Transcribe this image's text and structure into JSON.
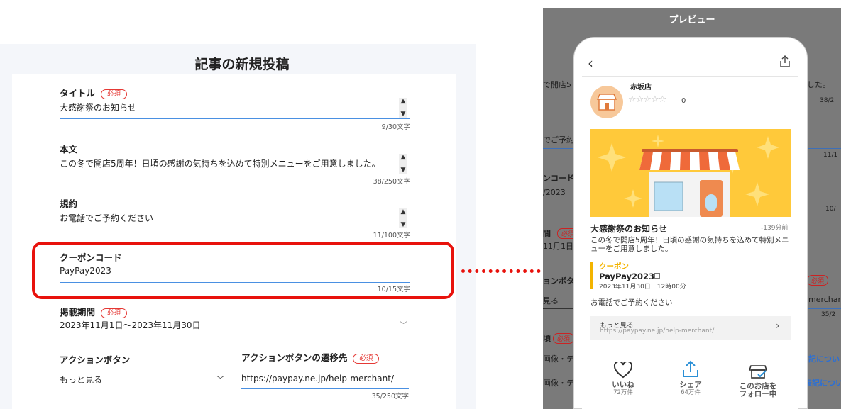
{
  "form": {
    "title": "記事の新規投稿",
    "required_label": "必須",
    "fields": {
      "title": {
        "label": "タイトル",
        "value": "大感謝祭のお知らせ",
        "count": "9/30文字"
      },
      "body": {
        "label": "本文",
        "value": "この冬で開店5周年！日頃の感謝の気持ちを込めて特別メニューをご用意しました。",
        "count": "38/250文字"
      },
      "terms": {
        "label": "規約",
        "value": "お電話でご予約ください",
        "count": "11/100文字"
      },
      "coupon": {
        "label": "クーポンコード",
        "value": "PayPay2023",
        "count": "10/15文字"
      },
      "period": {
        "label": "掲載期間",
        "value": "2023年11月1日～2023年11月30日"
      },
      "action_button": {
        "label": "アクションボタン",
        "value": "もっと見る"
      },
      "action_url": {
        "label": "アクションボタンの遷移先",
        "value": "https://paypay.ne.jp/help-merchant/",
        "count": "35/250文字"
      }
    }
  },
  "preview": {
    "title": "プレビュー",
    "shop_name": "赤坂店",
    "rating_count": "0",
    "post_title": "大感謝祭のお知らせ",
    "post_time": "-139分前",
    "post_body": "この冬で開店5周年！日頃の感謝の気持ちを込めて特別メニューをご用意しました。",
    "coupon_label": "クーポン",
    "coupon_code": "PayPay2023",
    "coupon_date": "2023年11月30日｜12時00分",
    "terms": "お電話でご予約ください",
    "more_label": "もっと見る",
    "more_url": "https://paypay.ne.jp/help-merchant/",
    "actions": {
      "like": {
        "label": "いいね",
        "count": "72万件"
      },
      "share": {
        "label": "シェア",
        "count": "64万件"
      },
      "follow": {
        "label": "このお店を",
        "label2": "フォロー中"
      }
    },
    "background": {
      "t1": "で開店5",
      "t2": "した。",
      "t3": "38/2",
      "t4": "でご予約",
      "t5": "11/1",
      "t6": "ンコード",
      "t7": "/2023",
      "t8": "10/",
      "t9": "間",
      "t10": "必須",
      "t11": "11月1日",
      "t12": "ョンボタ",
      "t13": "必須",
      "t14": "見る",
      "t15": "merchant",
      "t16": "35/2",
      "t17": "頃",
      "t18": "必須",
      "t19": "画像・テ",
      "t20": "記につい",
      "t21": "画像・テ",
      "t22": "表記につい"
    }
  },
  "colors": {
    "accent_red": "#e8120c",
    "field_line_blue": "#4a90e2",
    "coupon_yellow": "#f3b400",
    "banner_yellow": "#ffc93a"
  },
  "icons": [
    "back-icon",
    "share-icon",
    "shop-avatar-icon",
    "star-icon",
    "copy-icon",
    "chevron-right-icon",
    "heart-icon",
    "store-follow-icon",
    "chevron-down-icon",
    "spinner-arrows-icon"
  ]
}
